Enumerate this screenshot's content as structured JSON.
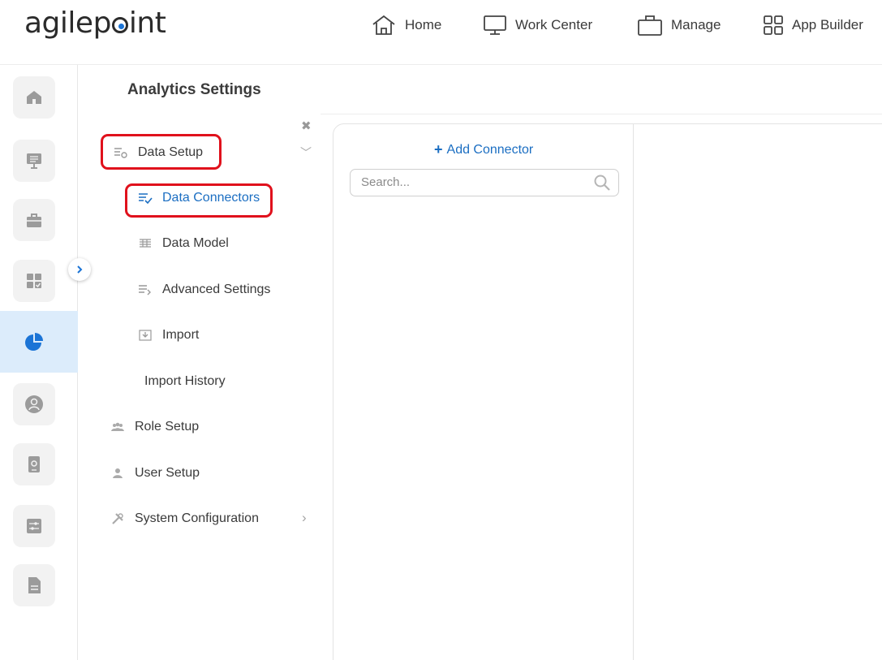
{
  "brand": {
    "logo_prefix": "agilep",
    "logo_suffix": "int"
  },
  "topnav": [
    {
      "label": "Home",
      "icon": "home-icon"
    },
    {
      "label": "Work Center",
      "icon": "monitor-icon"
    },
    {
      "label": "Manage",
      "icon": "briefcase-icon"
    },
    {
      "label": "App Builder",
      "icon": "grid-icon"
    }
  ],
  "rail": [
    {
      "icon": "home-icon"
    },
    {
      "icon": "monitor-list-icon"
    },
    {
      "icon": "toolbox-icon"
    },
    {
      "icon": "dashboard-check-icon"
    },
    {
      "icon": "pie-chart-icon",
      "active": true
    },
    {
      "icon": "user-circle-icon"
    },
    {
      "icon": "mobile-settings-icon"
    },
    {
      "icon": "sliders-icon"
    },
    {
      "icon": "document-icon"
    }
  ],
  "settings": {
    "title": "Analytics Settings",
    "menu": {
      "data_setup": "Data Setup",
      "data_connectors": "Data Connectors",
      "data_model": "Data Model",
      "advanced_settings": "Advanced Settings",
      "import": "Import",
      "import_history": "Import History",
      "role_setup": "Role Setup",
      "user_setup": "User Setup",
      "system_configuration": "System Configuration"
    }
  },
  "content": {
    "add_connector": "Add Connector",
    "search_placeholder": "Search..."
  },
  "colors": {
    "accent": "#1b6ec2",
    "highlight": "#e0111c",
    "active_rail": "#dcecfb"
  }
}
